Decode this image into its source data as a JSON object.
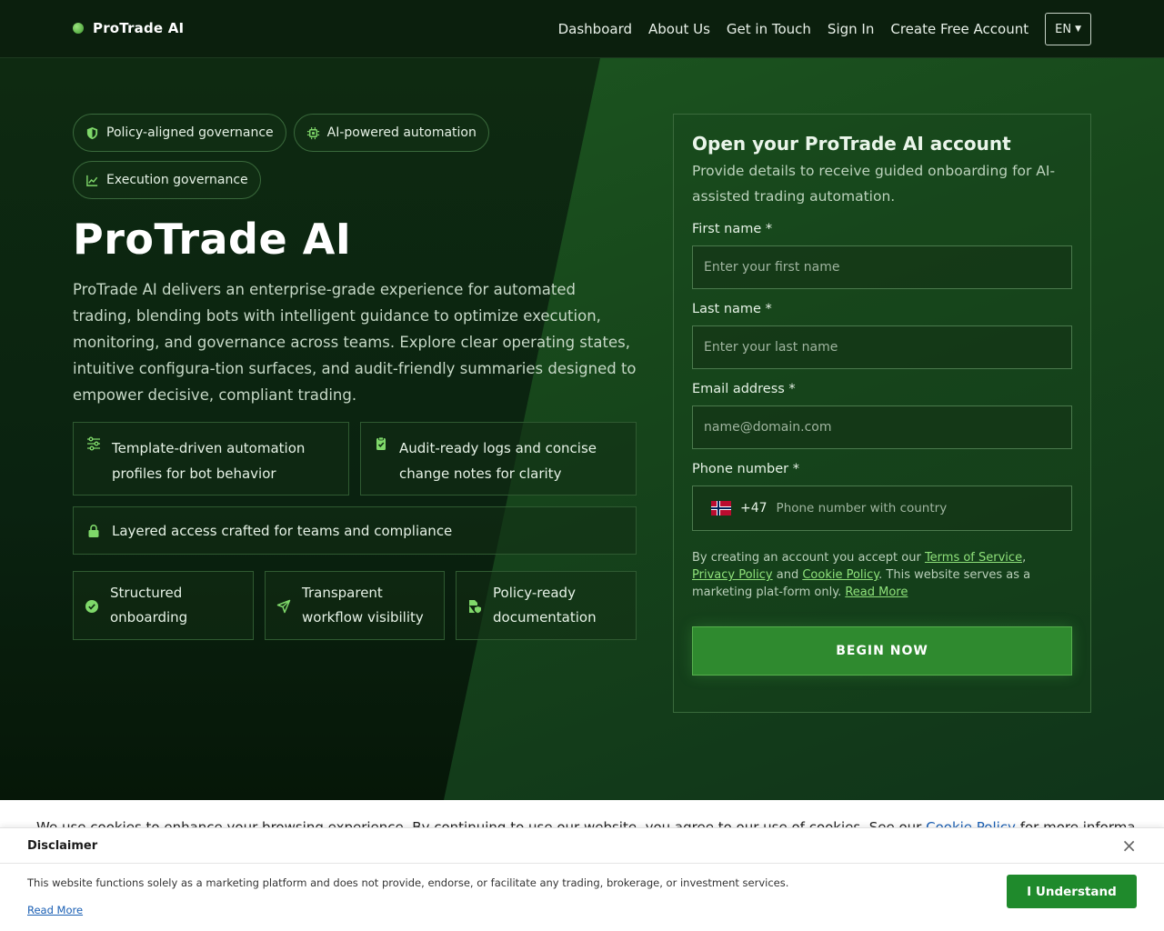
{
  "nav": {
    "brand": "ProTrade AI",
    "links": [
      "Dashboard",
      "About Us",
      "Get in Touch",
      "Sign In",
      "Create Free Account"
    ],
    "language": "EN"
  },
  "hero": {
    "badges": [
      "Policy-aligned governance",
      "AI-powered automation",
      "Execution governance"
    ],
    "title": "ProTrade AI",
    "description": "ProTrade AI delivers an enterprise-grade experience for automated trading, blending bots with intelligent guidance to optimize execution, monitoring, and governance across teams. Explore clear operating states, intuitive configura-tion surfaces, and audit-friendly summaries designed to empower decisive, compliant trading.",
    "features": {
      "template": "Template-driven automation profiles for bot behavior",
      "audit": "Audit-ready logs and concise change notes for clarity",
      "access": "Layered access crafted for teams and compliance",
      "onboarding": "Structured onboarding",
      "workflow": "Transparent workflow visibility",
      "docs": "Policy-ready documentation"
    }
  },
  "form": {
    "title": "Open your ProTrade AI account",
    "subtitle": "Provide details to receive guided onboarding for AI-assisted trading automation.",
    "first_name_label": "First name *",
    "first_name_placeholder": "Enter your first name",
    "last_name_label": "Last name *",
    "last_name_placeholder": "Enter your last name",
    "email_label": "Email address *",
    "email_placeholder": "name@domain.com",
    "phone_label": "Phone number *",
    "phone_dial_code": "+47",
    "phone_placeholder": "Phone number with country",
    "terms": {
      "prefix": "By creating an account you accept our ",
      "tos": "Terms of Service",
      "comma": ", ",
      "privacy": "Privacy Policy",
      "and": " and ",
      "cookie": "Cookie Policy",
      "suffix": ". This website serves as a marketing plat-form only. ",
      "read_more": "Read More"
    },
    "submit": "BEGIN NOW"
  },
  "cookie_bar": {
    "text": "We use cookies to enhance your browsing experience. By continuing to use our website, you agree to our use of cookies. See our ",
    "link": "Cookie Policy",
    "suffix": " for more informa"
  },
  "disclaimer": {
    "title": "Disclaimer",
    "body": "This website functions solely as a marketing platform and does not provide, endorse, or facilitate any trading, brokerage, or investment services.",
    "read_more": "Read More",
    "button": "I Understand",
    "close": "×"
  },
  "colors": {
    "accent": "#2f8a2f",
    "link": "#8fe27a",
    "icon": "#7fd86a"
  }
}
